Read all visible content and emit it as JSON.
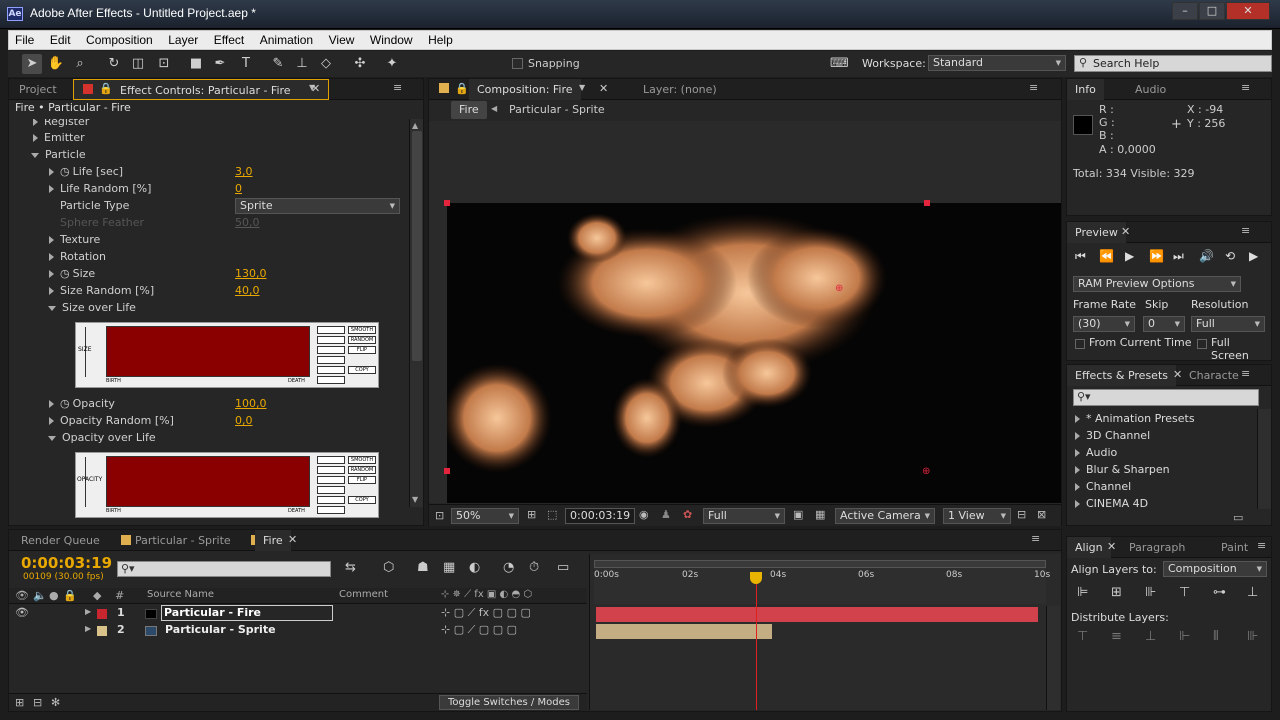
{
  "window": {
    "title": "Adobe After Effects - Untitled Project.aep *",
    "logo": "Ae",
    "min": "–",
    "max": "□",
    "close": "✕"
  },
  "menu": [
    "File",
    "Edit",
    "Composition",
    "Layer",
    "Effect",
    "Animation",
    "View",
    "Window",
    "Help"
  ],
  "toolbar": {
    "snapping": "Snapping",
    "workspace_label": "Workspace:",
    "workspace_value": "Standard",
    "search_placeholder": "Search Help"
  },
  "left_panel": {
    "tabs": {
      "project": "Project",
      "effect_controls": "Effect Controls: Particular - Fire"
    },
    "header": "Fire • Particular - Fire",
    "props": [
      {
        "label": "Register",
        "indent": 1
      },
      {
        "label": "Emitter",
        "indent": 1
      },
      {
        "label": "Particle",
        "indent": 1
      },
      {
        "label": "Life [sec]",
        "value": "3,0"
      },
      {
        "label": "Life Random [%]",
        "value": "0"
      },
      {
        "label": "Particle Type",
        "value": "Sprite"
      },
      {
        "label": "Sphere Feather",
        "value": "50,0"
      },
      {
        "label": "Texture"
      },
      {
        "label": "Rotation"
      },
      {
        "label": "Size",
        "value": "130,0"
      },
      {
        "label": "Size Random [%]",
        "value": "40,0"
      },
      {
        "label": "Size over Life"
      },
      {
        "label": "Opacity",
        "value": "100,0"
      },
      {
        "label": "Opacity Random [%]",
        "value": "0,0"
      },
      {
        "label": "Opacity over Life"
      }
    ],
    "graph1": {
      "axis": "SIZE",
      "birth": "BIRTH",
      "death": "DEATH"
    },
    "graph2": {
      "axis": "OPACITY",
      "birth": "BIRTH",
      "death": "DEATH"
    },
    "graph_buttons": [
      "SMOOTH",
      "RANDOM",
      "FLIP",
      "COPY"
    ]
  },
  "comp_panel": {
    "tab": "Composition: Fire",
    "layer_tab": "Layer: (none)",
    "breadcrumb": [
      "Fire",
      "Particular - Sprite"
    ],
    "zoom": "50%",
    "timecode": "0:00:03:19",
    "resolution": "Full",
    "camera": "Active Camera",
    "views": "1 View"
  },
  "info_panel": {
    "tabs": [
      "Info",
      "Audio"
    ],
    "r": "R :",
    "g": "G :",
    "b": "B :",
    "a": "A : 0,0000",
    "x": "X : -94",
    "y": "Y : 256",
    "total": "Total: 334  Visible: 329"
  },
  "preview_panel": {
    "tab": "Preview",
    "ram_options": "RAM Preview Options",
    "frame_rate_label": "Frame Rate",
    "skip_label": "Skip",
    "resolution_label": "Resolution",
    "frame_rate": "(30)",
    "skip": "0",
    "resolution": "Full",
    "from_current": "From Current Time",
    "full_screen": "Full Screen"
  },
  "effects_panel": {
    "tabs": [
      "Effects & Presets",
      "Characte"
    ],
    "items": [
      "* Animation Presets",
      "3D Channel",
      "Audio",
      "Blur & Sharpen",
      "Channel",
      "CINEMA 4D"
    ]
  },
  "align_panel": {
    "tabs": [
      "Align",
      "Paragraph",
      "Paint"
    ],
    "align_to_label": "Align Layers to:",
    "align_to": "Composition",
    "distribute": "Distribute Layers:"
  },
  "timeline": {
    "tabs": [
      "Render Queue",
      "Particular - Sprite",
      "Fire"
    ],
    "timecode": "0:00:03:19",
    "frame_info": "00109 (30.00 fps)",
    "col_source": "Source Name",
    "col_comment": "Comment",
    "col_num": "#",
    "layers": [
      {
        "num": "1",
        "name": "Particular - Fire",
        "color": "#c8262e"
      },
      {
        "num": "2",
        "name": "Particular - Sprite",
        "color": "#d9c38a"
      }
    ],
    "ruler": [
      "0:00s",
      "02s",
      "04s",
      "06s",
      "08s",
      "10s"
    ],
    "toggle": "Toggle Switches / Modes"
  },
  "colors": {
    "accent": "#e8a800",
    "layer1": "#d2424c",
    "layer2": "#c5ad83",
    "playhead": "#e0201e"
  }
}
